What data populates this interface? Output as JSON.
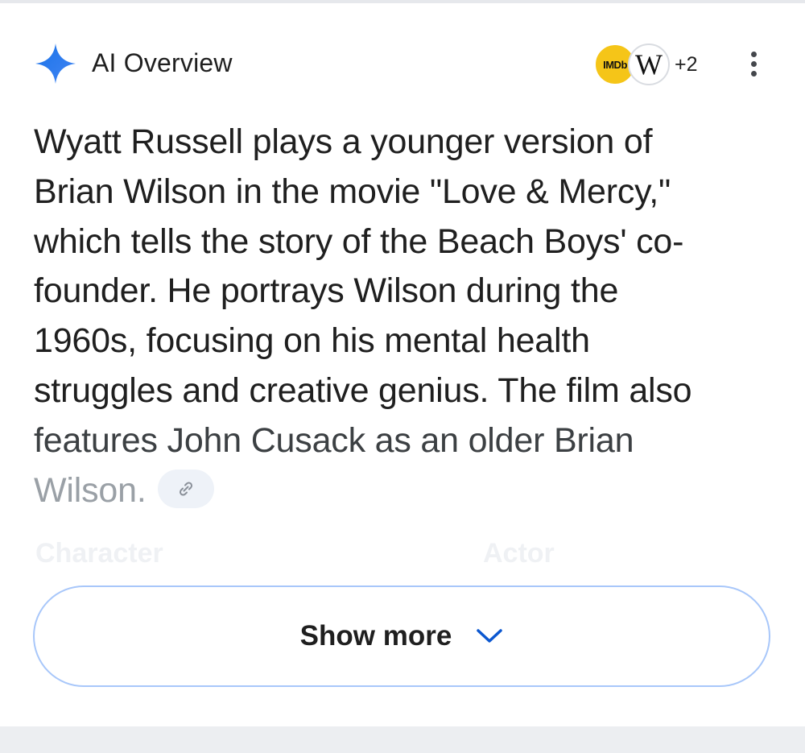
{
  "header": {
    "title": "AI Overview",
    "sparkle_icon": "sparkle-icon",
    "sources": [
      {
        "name": "imdb",
        "label": "IMDb",
        "color": "#f5c518"
      },
      {
        "name": "wikipedia",
        "label": "W",
        "color": "#ffffff"
      }
    ],
    "more_sources": "+2",
    "menu_icon": "more-vert-icon"
  },
  "overview": {
    "lines": [
      "Wyatt Russell plays a younger version of",
      "Brian Wilson in the movie \"Love & Mercy,\"",
      "which tells the story of the Beach Boys' co-",
      "founder. He portrays Wilson during the",
      "1960s, focusing on his mental health",
      "struggles and creative genius. The film also",
      "features John Cusack as an older Brian",
      "Wilson."
    ],
    "link_icon": "link-icon"
  },
  "table_preview": {
    "headers": [
      "Character",
      "Actor"
    ]
  },
  "show_more": {
    "label": "Show more",
    "icon": "chevron-down-icon"
  },
  "colors": {
    "accent": "#0b57d0",
    "border": "#a8c7fa",
    "text": "#1f1f1f"
  }
}
